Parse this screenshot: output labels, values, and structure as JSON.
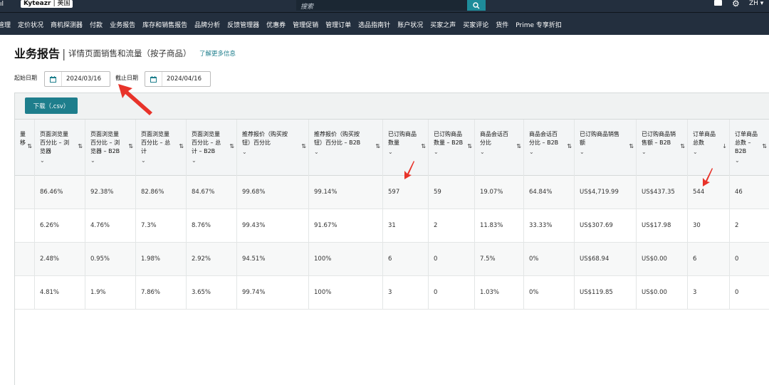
{
  "topbar": {
    "edge_fragment": "ıl",
    "brand_name": "Kyteazr",
    "brand_region": "美国",
    "search_placeholder": "搜索",
    "language": "ZH"
  },
  "nav": {
    "items": [
      "管理",
      "定价状况",
      "商机探测器",
      "付款",
      "业务报告",
      "库存和销售报告",
      "品牌分析",
      "反馈管理器",
      "优惠券",
      "管理促销",
      "管理订单",
      "选品指南针",
      "账户状况",
      "买家之声",
      "买家评论",
      "货件",
      "Prime 专享折扣"
    ]
  },
  "page": {
    "title": "业务报告",
    "separator": "|",
    "subtitle": "详情页面销售和流量（按子商品）",
    "learn_more": "了解更多信息"
  },
  "dates": {
    "start_label": "起始日期",
    "start_value": "2024/03/16",
    "end_label": "截止日期",
    "end_value": "2024/04/16"
  },
  "toolbar": {
    "download_label": "下载（.csv）"
  },
  "table": {
    "headers": [
      {
        "label": "量\n移",
        "sort": "⇅"
      },
      {
        "label": "页面浏览量\n百分比 – 浏\n览器",
        "sort": "⇅"
      },
      {
        "label": "页面浏览量\n百分比 – 浏\n览器 – B2B",
        "sort": "⇅"
      },
      {
        "label": "页面浏览量\n百分比 – 总\n计",
        "sort": "⇅"
      },
      {
        "label": "页面浏览量\n百分比 – 总\n计 – B2B",
        "sort": "⇅"
      },
      {
        "label": "推荐报价（购买按\n钮）百分比",
        "sort": "⇅"
      },
      {
        "label": "推荐报价（购买按\n钮）百分比 – B2B",
        "sort": "⇅"
      },
      {
        "label": "已订购商品\n数量",
        "sort": "⇅"
      },
      {
        "label": "已订购商品\n数量 – B2B",
        "sort": "⇅"
      },
      {
        "label": "商品会话百\n分比",
        "sort": "⇅"
      },
      {
        "label": "商品会话百\n分比 – B2B",
        "sort": "⇅"
      },
      {
        "label": "已订购商品销售\n额",
        "sort": "⇅"
      },
      {
        "label": "已订购商品销\n售额 – B2B",
        "sort": "⇅"
      },
      {
        "label": "订单商品\n总数",
        "sort": "↓"
      },
      {
        "label": "订单商品\n总数 –\nB2B",
        "sort": "⇅"
      }
    ],
    "rows": [
      [
        "",
        "86.46%",
        "92.38%",
        "82.86%",
        "84.67%",
        "99.68%",
        "99.14%",
        "597",
        "59",
        "19.07%",
        "64.84%",
        "US$4,719.99",
        "US$437.35",
        "544",
        "46"
      ],
      [
        "",
        "6.26%",
        "4.76%",
        "7.3%",
        "8.76%",
        "99.43%",
        "91.67%",
        "31",
        "2",
        "11.83%",
        "33.33%",
        "US$307.69",
        "US$17.98",
        "30",
        "2"
      ],
      [
        "",
        "2.48%",
        "0.95%",
        "1.98%",
        "2.92%",
        "94.51%",
        "100%",
        "6",
        "0",
        "7.5%",
        "0%",
        "US$68.94",
        "US$0.00",
        "6",
        "0"
      ],
      [
        "",
        "4.81%",
        "1.9%",
        "7.86%",
        "3.65%",
        "99.74%",
        "100%",
        "3",
        "0",
        "1.03%",
        "0%",
        "US$119.85",
        "US$0.00",
        "3",
        "0"
      ]
    ]
  },
  "colors": {
    "header_bg": "#232f3e",
    "accent": "#1e7e8c",
    "annotation_arrow": "#e8332a",
    "row_alt": "#f7f8f8"
  }
}
